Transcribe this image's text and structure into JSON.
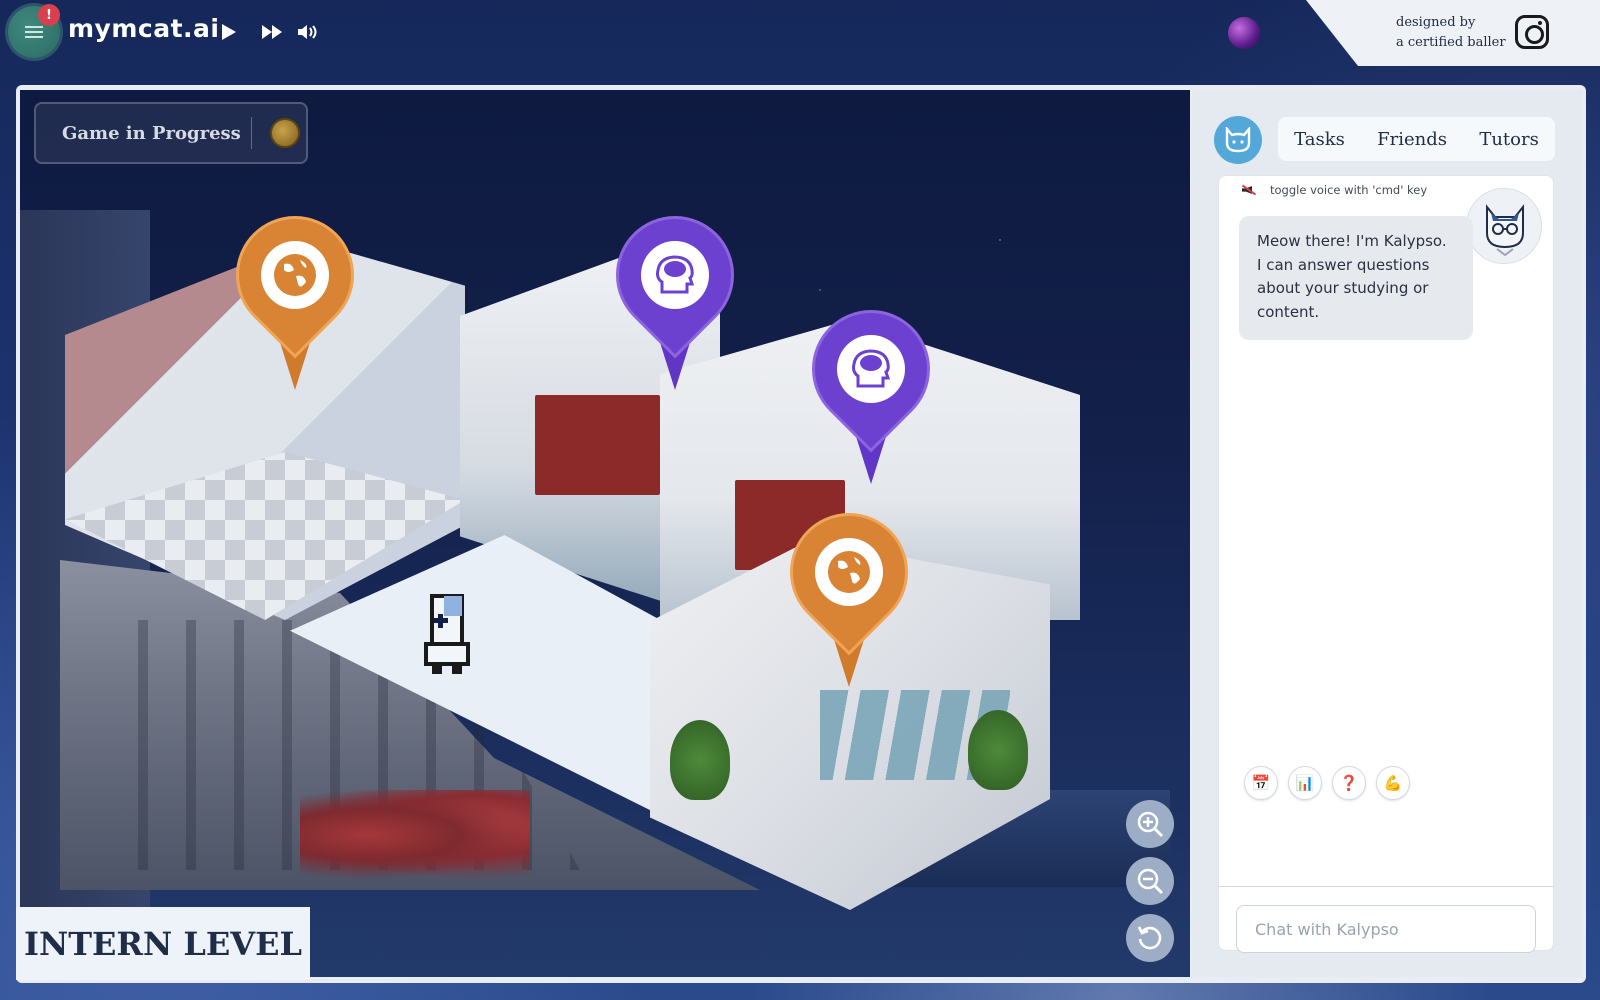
{
  "topbar": {
    "brand": "mymcat.ai",
    "alert_badge": "!",
    "credit_line1": "designed by",
    "credit_line2": "a certified baller",
    "icons": {
      "menu": "hamburger-menu-icon",
      "play": "play-icon",
      "fast_forward": "fast-forward-icon",
      "volume": "volume-icon",
      "orb": "purple-orb-icon",
      "instagram": "instagram-icon"
    }
  },
  "game": {
    "status": "Game in Progress",
    "level": "INTERN LEVEL",
    "pins": [
      {
        "name": "globe",
        "color": "#d88434",
        "icon": "globe-icon"
      },
      {
        "name": "brain",
        "color": "#6d41cf",
        "icon": "brain-icon"
      },
      {
        "name": "brain",
        "color": "#6d41cf",
        "icon": "brain-icon"
      },
      {
        "name": "globe",
        "color": "#d88434",
        "icon": "globe-icon"
      }
    ],
    "zoom_controls": [
      "zoom-in-icon",
      "zoom-out-icon",
      "reset-icon"
    ]
  },
  "sidebar": {
    "tabs": [
      {
        "label": "Tasks"
      },
      {
        "label": "Friends"
      },
      {
        "label": "Tutors"
      }
    ],
    "voice_hint": "toggle voice with 'cmd' key",
    "assistant_message": "Meow there! I'm Kalypso. I can answer questions about your studying or content.",
    "quick_actions": [
      {
        "icon": "calendar-icon",
        "glyph": "📅"
      },
      {
        "icon": "bar-chart-icon",
        "glyph": "📊"
      },
      {
        "icon": "question-icon",
        "glyph": "❓"
      },
      {
        "icon": "flexed-biceps-icon",
        "glyph": "💪"
      }
    ],
    "chat_placeholder": "Chat with Kalypso"
  },
  "colors": {
    "accent_blue": "#54a8d9",
    "pin_orange": "#d88434",
    "pin_purple": "#6d41cf",
    "alert_red": "#d9404e"
  }
}
